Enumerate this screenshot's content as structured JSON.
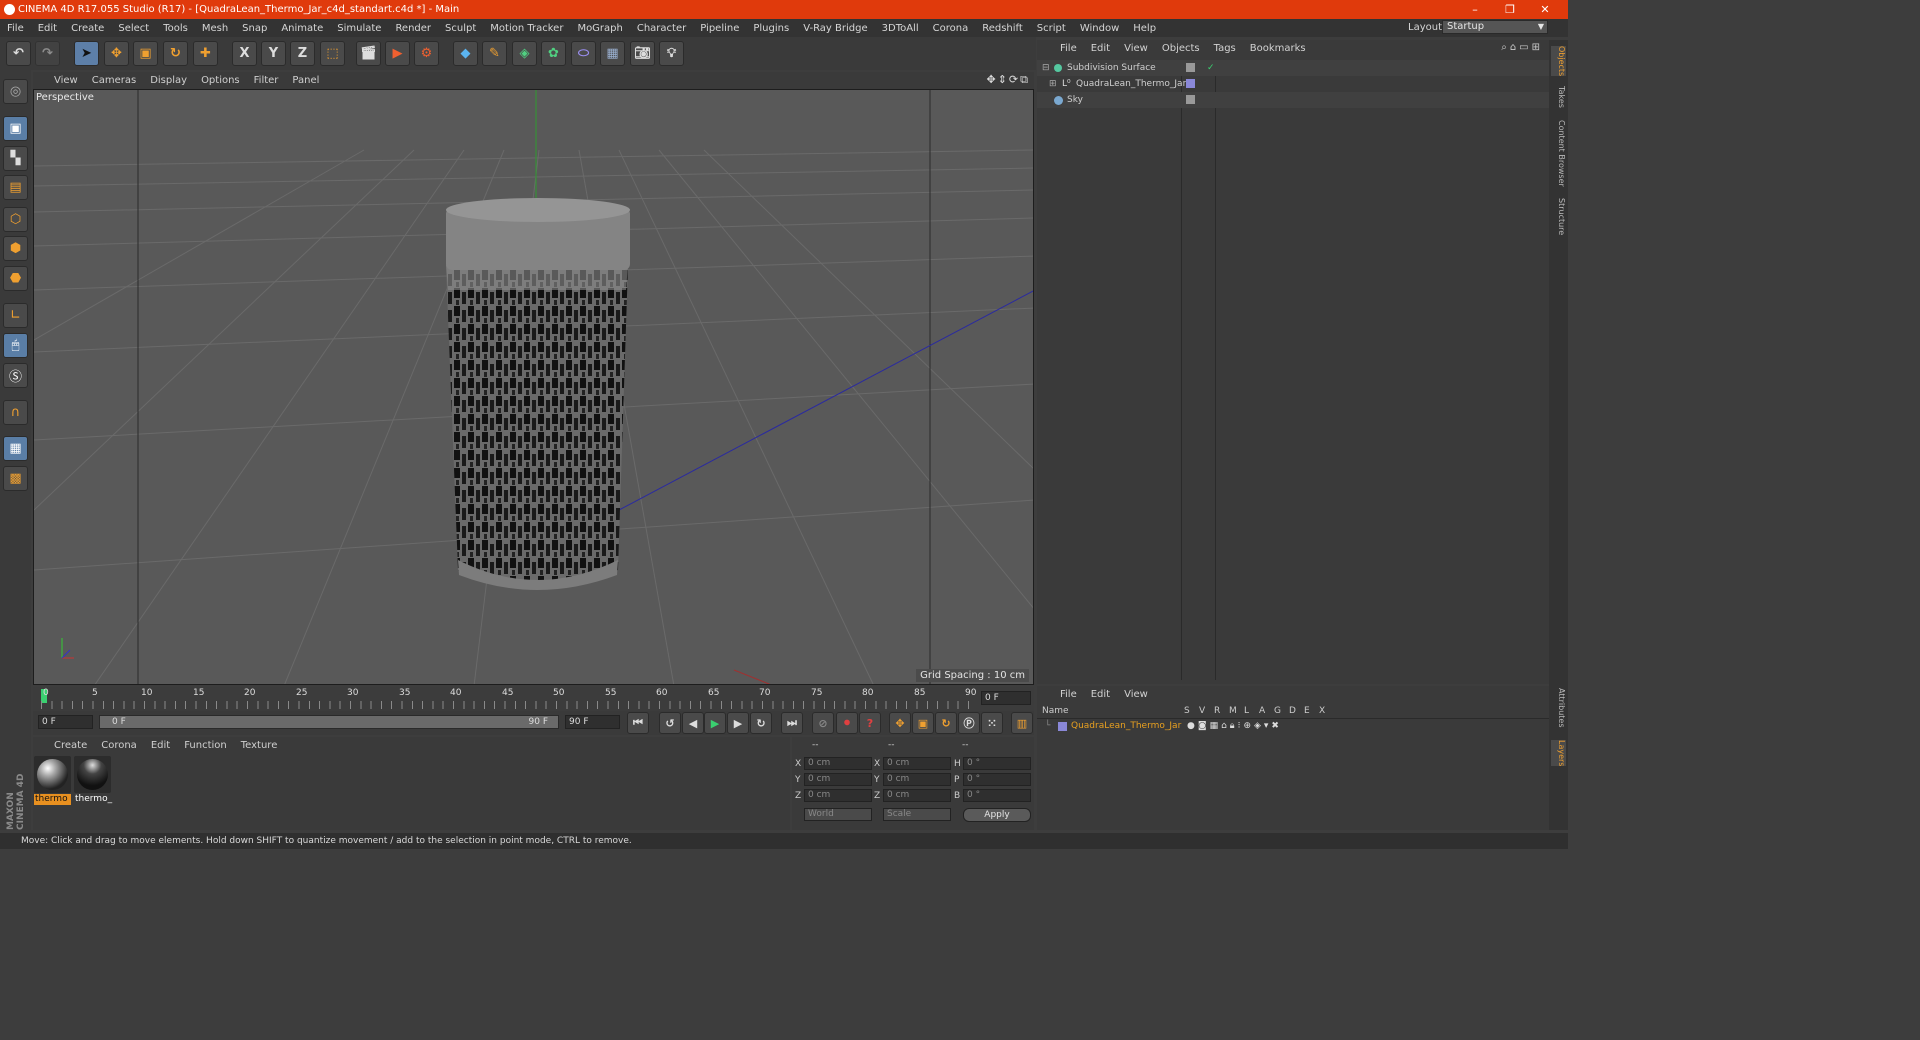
{
  "window": {
    "title": "CINEMA 4D R17.055 Studio (R17) - [QuadraLean_Thermo_Jar_c4d_standart.c4d *] - Main",
    "minimize": "–",
    "restore": "❐",
    "close": "✕"
  },
  "menu": [
    "File",
    "Edit",
    "Create",
    "Select",
    "Tools",
    "Mesh",
    "Snap",
    "Animate",
    "Simulate",
    "Render",
    "Sculpt",
    "Motion Tracker",
    "MoGraph",
    "Character",
    "Pipeline",
    "Plugins",
    "V-Ray Bridge",
    "3DToAll",
    "Corona",
    "Redshift",
    "Script",
    "Window",
    "Help"
  ],
  "layout": {
    "label": "Layout:",
    "value": "Startup"
  },
  "toolbar": {
    "x": "X",
    "y": "Y",
    "z": "Z"
  },
  "viewport": {
    "menu": [
      "View",
      "Cameras",
      "Display",
      "Options",
      "Filter",
      "Panel"
    ],
    "label": "Perspective",
    "grid_spacing": "Grid Spacing : 10 cm"
  },
  "timeline": {
    "ticks": [
      "0",
      "5",
      "10",
      "15",
      "20",
      "25",
      "30",
      "35",
      "40",
      "45",
      "50",
      "55",
      "60",
      "65",
      "70",
      "75",
      "80",
      "85",
      "90"
    ],
    "current_frame": "0 F",
    "start_field": "0 F",
    "range_start": "0 F",
    "range_end": "90 F",
    "end_field": "90 F"
  },
  "materials": {
    "menu": [
      "Create",
      "Corona",
      "Edit",
      "Function",
      "Texture"
    ],
    "items": [
      {
        "name": "thermo",
        "selected": true
      },
      {
        "name": "thermo_",
        "selected": false
      }
    ]
  },
  "coords": {
    "headers": [
      "--",
      "--",
      "--"
    ],
    "rows": [
      {
        "a": "X",
        "av": "0 cm",
        "b": "X",
        "bv": "0 cm",
        "c": "H",
        "cv": "0 °"
      },
      {
        "a": "Y",
        "av": "0 cm",
        "b": "Y",
        "bv": "0 cm",
        "c": "P",
        "cv": "0 °"
      },
      {
        "a": "Z",
        "av": "0 cm",
        "b": "Z",
        "bv": "0 cm",
        "c": "B",
        "cv": "0 °"
      }
    ],
    "world": "World",
    "scale": "Scale",
    "apply": "Apply"
  },
  "objects": {
    "menu": [
      "File",
      "Edit",
      "View",
      "Objects",
      "Tags",
      "Bookmarks"
    ],
    "items": [
      {
        "name": "Subdivision Surface",
        "color": "#55c8a0"
      },
      {
        "name": "QuadraLean_Thermo_Jar",
        "color": "#8a88d8"
      },
      {
        "name": "Sky",
        "color": "#7aa8d0"
      }
    ]
  },
  "layers": {
    "menu": [
      "File",
      "Edit",
      "View"
    ],
    "header": {
      "name": "Name",
      "cols": [
        "S",
        "V",
        "R",
        "M",
        "L",
        "A",
        "G",
        "D",
        "E",
        "X"
      ]
    },
    "item": "QuadraLean_Thermo_Jar",
    "item_color": "#e8a020"
  },
  "right_tabs": [
    "Objects",
    "Takes",
    "Content Browser",
    "Structure",
    "Attributes",
    "Layers"
  ],
  "brand": {
    "maxon": "MAXON",
    "product": "CINEMA 4D"
  },
  "status": "Move: Click and drag to move elements. Hold down SHIFT to quantize movement / add to the selection in point mode, CTRL to remove."
}
